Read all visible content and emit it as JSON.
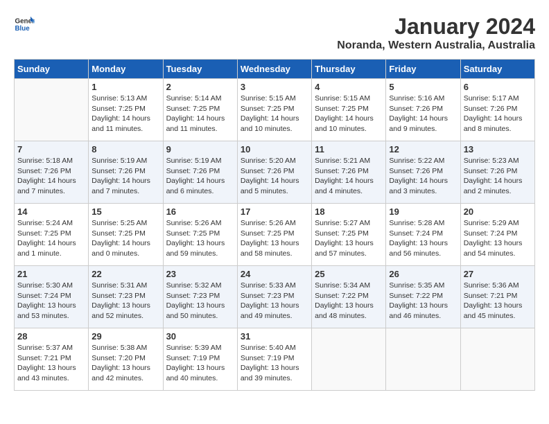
{
  "header": {
    "logo_line1": "General",
    "logo_line2": "Blue",
    "title": "January 2024",
    "subtitle": "Noranda, Western Australia, Australia"
  },
  "weekdays": [
    "Sunday",
    "Monday",
    "Tuesday",
    "Wednesday",
    "Thursday",
    "Friday",
    "Saturday"
  ],
  "weeks": [
    [
      {
        "day": "",
        "info": ""
      },
      {
        "day": "1",
        "info": "Sunrise: 5:13 AM\nSunset: 7:25 PM\nDaylight: 14 hours\nand 11 minutes."
      },
      {
        "day": "2",
        "info": "Sunrise: 5:14 AM\nSunset: 7:25 PM\nDaylight: 14 hours\nand 11 minutes."
      },
      {
        "day": "3",
        "info": "Sunrise: 5:15 AM\nSunset: 7:25 PM\nDaylight: 14 hours\nand 10 minutes."
      },
      {
        "day": "4",
        "info": "Sunrise: 5:15 AM\nSunset: 7:25 PM\nDaylight: 14 hours\nand 10 minutes."
      },
      {
        "day": "5",
        "info": "Sunrise: 5:16 AM\nSunset: 7:26 PM\nDaylight: 14 hours\nand 9 minutes."
      },
      {
        "day": "6",
        "info": "Sunrise: 5:17 AM\nSunset: 7:26 PM\nDaylight: 14 hours\nand 8 minutes."
      }
    ],
    [
      {
        "day": "7",
        "info": "Sunrise: 5:18 AM\nSunset: 7:26 PM\nDaylight: 14 hours\nand 7 minutes."
      },
      {
        "day": "8",
        "info": "Sunrise: 5:19 AM\nSunset: 7:26 PM\nDaylight: 14 hours\nand 7 minutes."
      },
      {
        "day": "9",
        "info": "Sunrise: 5:19 AM\nSunset: 7:26 PM\nDaylight: 14 hours\nand 6 minutes."
      },
      {
        "day": "10",
        "info": "Sunrise: 5:20 AM\nSunset: 7:26 PM\nDaylight: 14 hours\nand 5 minutes."
      },
      {
        "day": "11",
        "info": "Sunrise: 5:21 AM\nSunset: 7:26 PM\nDaylight: 14 hours\nand 4 minutes."
      },
      {
        "day": "12",
        "info": "Sunrise: 5:22 AM\nSunset: 7:26 PM\nDaylight: 14 hours\nand 3 minutes."
      },
      {
        "day": "13",
        "info": "Sunrise: 5:23 AM\nSunset: 7:26 PM\nDaylight: 14 hours\nand 2 minutes."
      }
    ],
    [
      {
        "day": "14",
        "info": "Sunrise: 5:24 AM\nSunset: 7:25 PM\nDaylight: 14 hours\nand 1 minute."
      },
      {
        "day": "15",
        "info": "Sunrise: 5:25 AM\nSunset: 7:25 PM\nDaylight: 14 hours\nand 0 minutes."
      },
      {
        "day": "16",
        "info": "Sunrise: 5:26 AM\nSunset: 7:25 PM\nDaylight: 13 hours\nand 59 minutes."
      },
      {
        "day": "17",
        "info": "Sunrise: 5:26 AM\nSunset: 7:25 PM\nDaylight: 13 hours\nand 58 minutes."
      },
      {
        "day": "18",
        "info": "Sunrise: 5:27 AM\nSunset: 7:25 PM\nDaylight: 13 hours\nand 57 minutes."
      },
      {
        "day": "19",
        "info": "Sunrise: 5:28 AM\nSunset: 7:24 PM\nDaylight: 13 hours\nand 56 minutes."
      },
      {
        "day": "20",
        "info": "Sunrise: 5:29 AM\nSunset: 7:24 PM\nDaylight: 13 hours\nand 54 minutes."
      }
    ],
    [
      {
        "day": "21",
        "info": "Sunrise: 5:30 AM\nSunset: 7:24 PM\nDaylight: 13 hours\nand 53 minutes."
      },
      {
        "day": "22",
        "info": "Sunrise: 5:31 AM\nSunset: 7:23 PM\nDaylight: 13 hours\nand 52 minutes."
      },
      {
        "day": "23",
        "info": "Sunrise: 5:32 AM\nSunset: 7:23 PM\nDaylight: 13 hours\nand 50 minutes."
      },
      {
        "day": "24",
        "info": "Sunrise: 5:33 AM\nSunset: 7:23 PM\nDaylight: 13 hours\nand 49 minutes."
      },
      {
        "day": "25",
        "info": "Sunrise: 5:34 AM\nSunset: 7:22 PM\nDaylight: 13 hours\nand 48 minutes."
      },
      {
        "day": "26",
        "info": "Sunrise: 5:35 AM\nSunset: 7:22 PM\nDaylight: 13 hours\nand 46 minutes."
      },
      {
        "day": "27",
        "info": "Sunrise: 5:36 AM\nSunset: 7:21 PM\nDaylight: 13 hours\nand 45 minutes."
      }
    ],
    [
      {
        "day": "28",
        "info": "Sunrise: 5:37 AM\nSunset: 7:21 PM\nDaylight: 13 hours\nand 43 minutes."
      },
      {
        "day": "29",
        "info": "Sunrise: 5:38 AM\nSunset: 7:20 PM\nDaylight: 13 hours\nand 42 minutes."
      },
      {
        "day": "30",
        "info": "Sunrise: 5:39 AM\nSunset: 7:19 PM\nDaylight: 13 hours\nand 40 minutes."
      },
      {
        "day": "31",
        "info": "Sunrise: 5:40 AM\nSunset: 7:19 PM\nDaylight: 13 hours\nand 39 minutes."
      },
      {
        "day": "",
        "info": ""
      },
      {
        "day": "",
        "info": ""
      },
      {
        "day": "",
        "info": ""
      }
    ]
  ]
}
